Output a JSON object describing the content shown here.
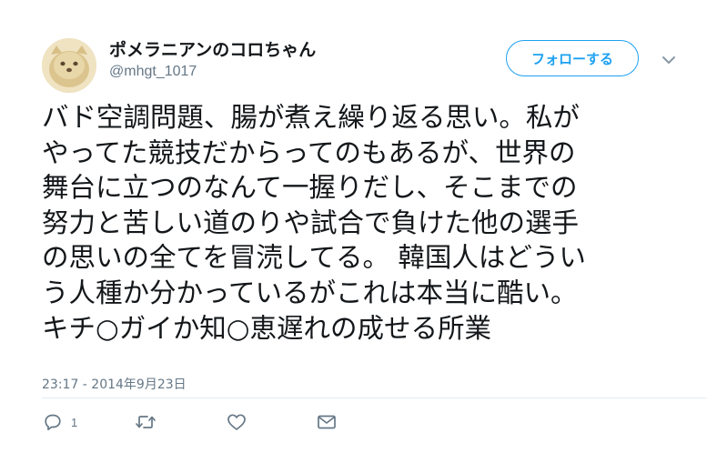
{
  "user": {
    "display_name": "ポメラニアンのコロちゃん",
    "handle": "@mhgt_1017"
  },
  "header": {
    "follow_label": "フォローする"
  },
  "tweet": {
    "lines": [
      "バド空調問題、腸が煮え繰り返る思い。私が",
      "やってた競技だからってのもあるが、世界の",
      "舞台に立つのなんて一握りだし、そこまでの",
      "努力と苦しい道のりや試合で負けた他の選手",
      "の思いの全てを冒涜してる。 韓国人はどうい",
      "う人種か分かっているがこれは本当に酷い。",
      "キチ○ガイか知○恵遅れの成せる所業"
    ],
    "timestamp": "23:17 - 2014年9月23日"
  },
  "actions": {
    "reply_count": "1"
  },
  "colors": {
    "accent": "#1da1f2",
    "muted": "#657786",
    "text": "#14171a"
  },
  "icons": [
    "reply-icon",
    "retweet-icon",
    "like-icon",
    "direct-message-icon",
    "chevron-down-icon"
  ]
}
